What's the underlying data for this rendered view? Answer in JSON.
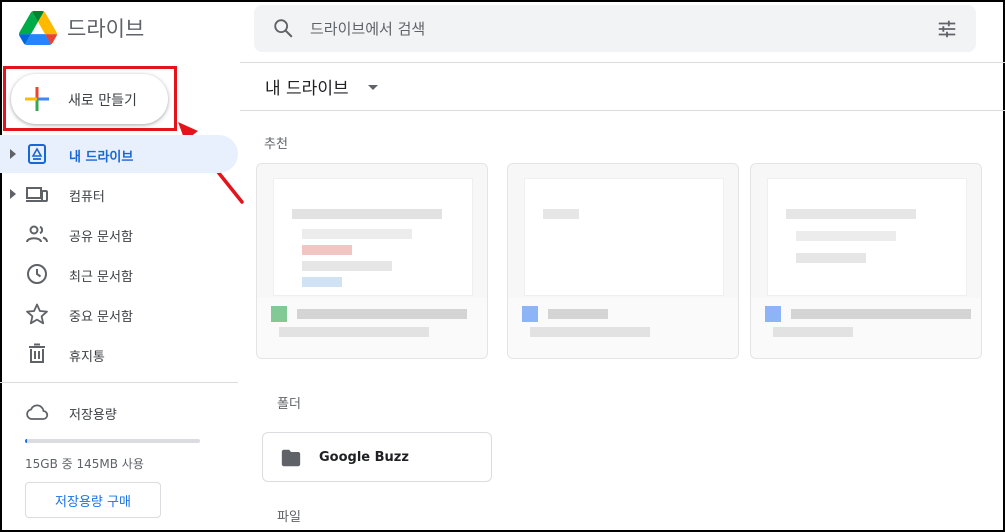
{
  "app": {
    "title": "드라이브"
  },
  "search": {
    "placeholder": "드라이브에서 검색",
    "value": ""
  },
  "new_button": {
    "label": "새로 만들기"
  },
  "sidebar": {
    "items": [
      {
        "label": "내 드라이브",
        "icon": "my-drive-icon",
        "active": true,
        "expandable": true
      },
      {
        "label": "컴퓨터",
        "icon": "computers-icon",
        "active": false,
        "expandable": true
      },
      {
        "label": "공유 문서함",
        "icon": "shared-people-icon",
        "active": false,
        "expandable": false
      },
      {
        "label": "최근 문서함",
        "icon": "clock-icon",
        "active": false,
        "expandable": false
      },
      {
        "label": "중요 문서함",
        "icon": "star-icon",
        "active": false,
        "expandable": false
      },
      {
        "label": "휴지통",
        "icon": "trash-icon",
        "active": false,
        "expandable": false
      }
    ]
  },
  "storage": {
    "label": "저장용량",
    "usage_text": "15GB 중 145MB 사용",
    "used_fraction": 0.01,
    "buy_label": "저장용량 구매"
  },
  "main": {
    "breadcrumb": "내 드라이브",
    "recommended_title": "추천",
    "folders_title": "폴더",
    "files_title": "파일",
    "folders": [
      {
        "name": "Google Buzz"
      }
    ]
  },
  "colors": {
    "accent": "#1a73e8",
    "active_bg": "#e8f0fe",
    "annotation_red": "#e3141c"
  }
}
